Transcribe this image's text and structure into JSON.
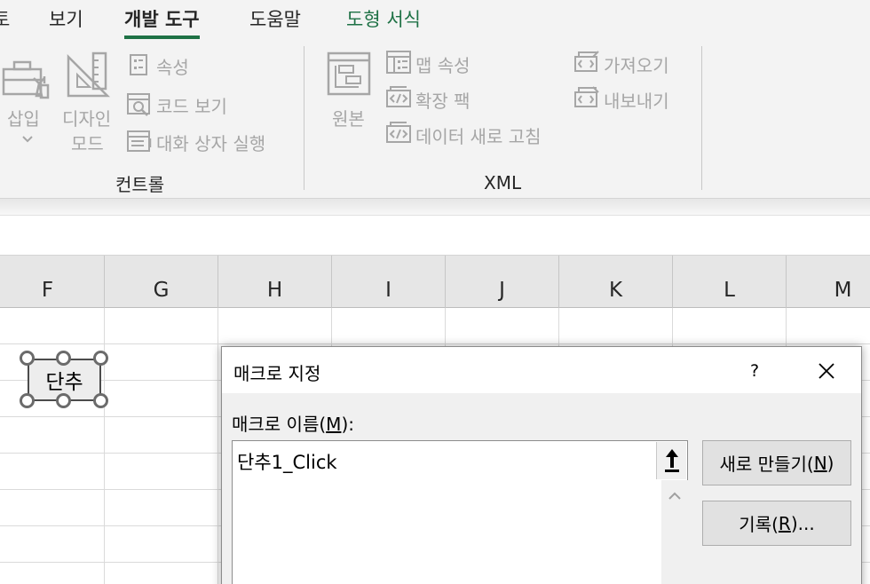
{
  "ribbon_tabs": {
    "partial": "토",
    "view": "보기",
    "developer": "개발 도구",
    "help": "도움말",
    "shape_format": "도형 서식"
  },
  "controls_group": {
    "insert_label": "삽입",
    "design_mode_line1": "디자인",
    "design_mode_line2": "모드",
    "properties": "속성",
    "view_code": "코드 보기",
    "run_dialog": "대화 상자 실행",
    "group_label": "컨트롤"
  },
  "xml_group": {
    "source": "원본",
    "map_properties": "맵 속성",
    "expansion_packs": "확장 팩",
    "refresh_data": "데이터 새로 고침",
    "import": "가져오기",
    "export": "내보내기",
    "group_label": "XML"
  },
  "columns": [
    "F",
    "G",
    "H",
    "I",
    "J",
    "K",
    "L",
    "M"
  ],
  "sheet_button": {
    "label": "단추"
  },
  "dialog": {
    "title": "매크로 지정",
    "help": "?",
    "macro_name_label": "매크로 이름(",
    "macro_name_key": "M",
    "macro_name_suffix": "):",
    "macro_name_value": "단추1_Click",
    "new_button_prefix": "새로 만들기(",
    "new_button_key": "N",
    "new_button_suffix": ")",
    "record_button_prefix": "기록(",
    "record_button_key": "R",
    "record_button_suffix": ")..."
  },
  "colors": {
    "accent_green": "#1e7145",
    "disabled_text": "#a6a6a6",
    "ribbon_bg": "#f3f3f3"
  },
  "icons": [
    "toolbox-icon",
    "design-mode-icon",
    "properties-icon",
    "view-code-icon",
    "run-dialog-icon",
    "xml-source-icon",
    "map-properties-icon",
    "expansion-packs-icon",
    "refresh-data-icon",
    "import-icon",
    "export-icon",
    "collapse-dialog-icon",
    "close-icon",
    "scroll-up-icon"
  ]
}
